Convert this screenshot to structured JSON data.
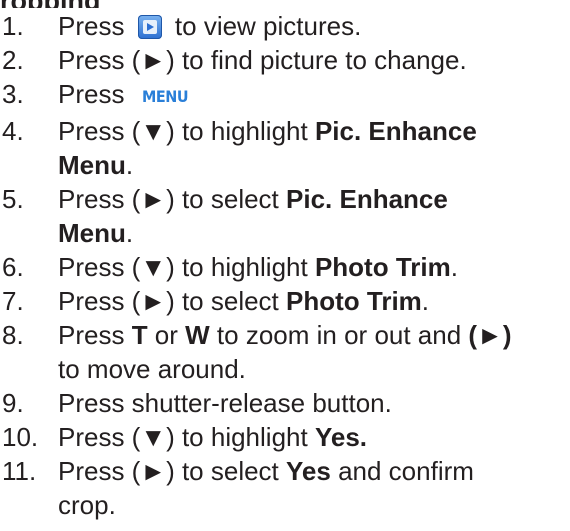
{
  "heading_fragment": "ropping",
  "icons": {
    "playback": "playback-button-icon",
    "menu_label": "MENU"
  },
  "steps": [
    {
      "num": "1.",
      "a": "Press ",
      "b": " to view pictures."
    },
    {
      "num": "2.",
      "text": "Press (►) to find picture to change."
    },
    {
      "num": "3.",
      "text": "Press "
    },
    {
      "num": "4.",
      "a": "Press (▼) to highlight ",
      "b": "Pic. Enhance",
      "c": "Menu",
      "d": "."
    },
    {
      "num": "5.",
      "a": "Press (►) to select ",
      "b": "Pic. Enhance",
      "c": "Menu",
      "d": "."
    },
    {
      "num": "6.",
      "a": "Press (▼) to highlight ",
      "b": "Photo Trim",
      "c": "."
    },
    {
      "num": "7.",
      "a": "Press (►) to select ",
      "b": "Photo Trim",
      "c": "."
    },
    {
      "num": "8.",
      "a": "Press ",
      "b": "T",
      "c": " or ",
      "d": "W",
      "e": " to zoom in or out and ",
      "f": "(►)",
      "g": "to move around."
    },
    {
      "num": "9.",
      "text": "Press shutter-release button."
    },
    {
      "num": "10.",
      "a": "Press (▼) to highlight ",
      "b": "Yes."
    },
    {
      "num": "11.",
      "a": "Press (►) to select ",
      "b": "Yes",
      "c": " and confirm",
      "d": "crop."
    }
  ]
}
